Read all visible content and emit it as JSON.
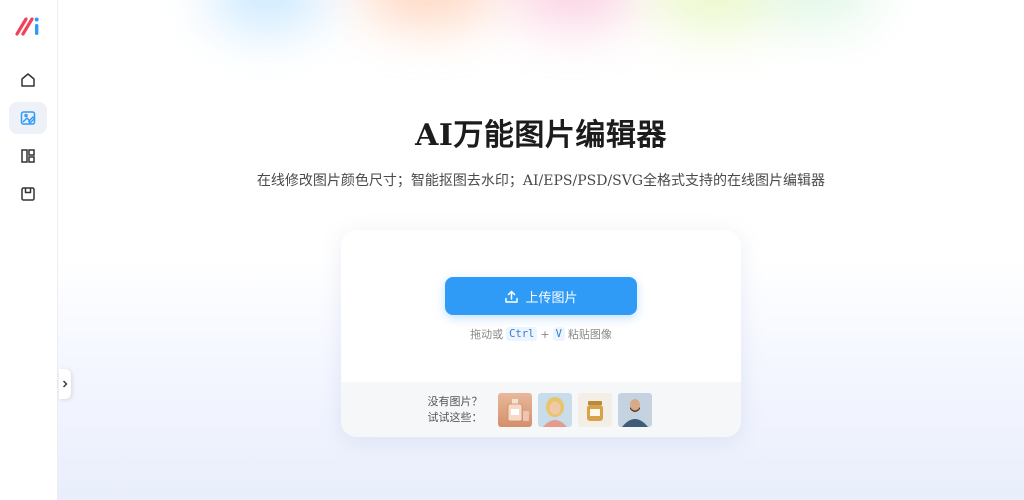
{
  "sidebar": {
    "logo": "ai-logo",
    "items": [
      {
        "name": "home",
        "icon": "home-icon"
      },
      {
        "name": "image-editor",
        "icon": "image-edit-icon",
        "active": true
      },
      {
        "name": "templates",
        "icon": "layout-icon"
      },
      {
        "name": "saved",
        "icon": "save-icon"
      }
    ]
  },
  "hero": {
    "title": "AI万能图片编辑器",
    "subtitle": "在线修改图片颜色尺寸；智能抠图去水印；AI/EPS/PSD/SVG全格式支持的在线图片编辑器"
  },
  "upload": {
    "button_label": "上传图片",
    "hint_prefix": "拖动或",
    "hint_key1": "Ctrl",
    "hint_plus": "+",
    "hint_key2": "V",
    "hint_suffix": "粘贴图像"
  },
  "samples": {
    "label_line1": "没有图片？",
    "label_line2": "试试这些：",
    "items": [
      "perfume-bottle",
      "blonde-woman",
      "candle-jar",
      "bearded-man"
    ]
  },
  "colors": {
    "accent": "#2f9bf7",
    "logo_red": "#f0435a",
    "logo_blue": "#2f9bf7"
  }
}
